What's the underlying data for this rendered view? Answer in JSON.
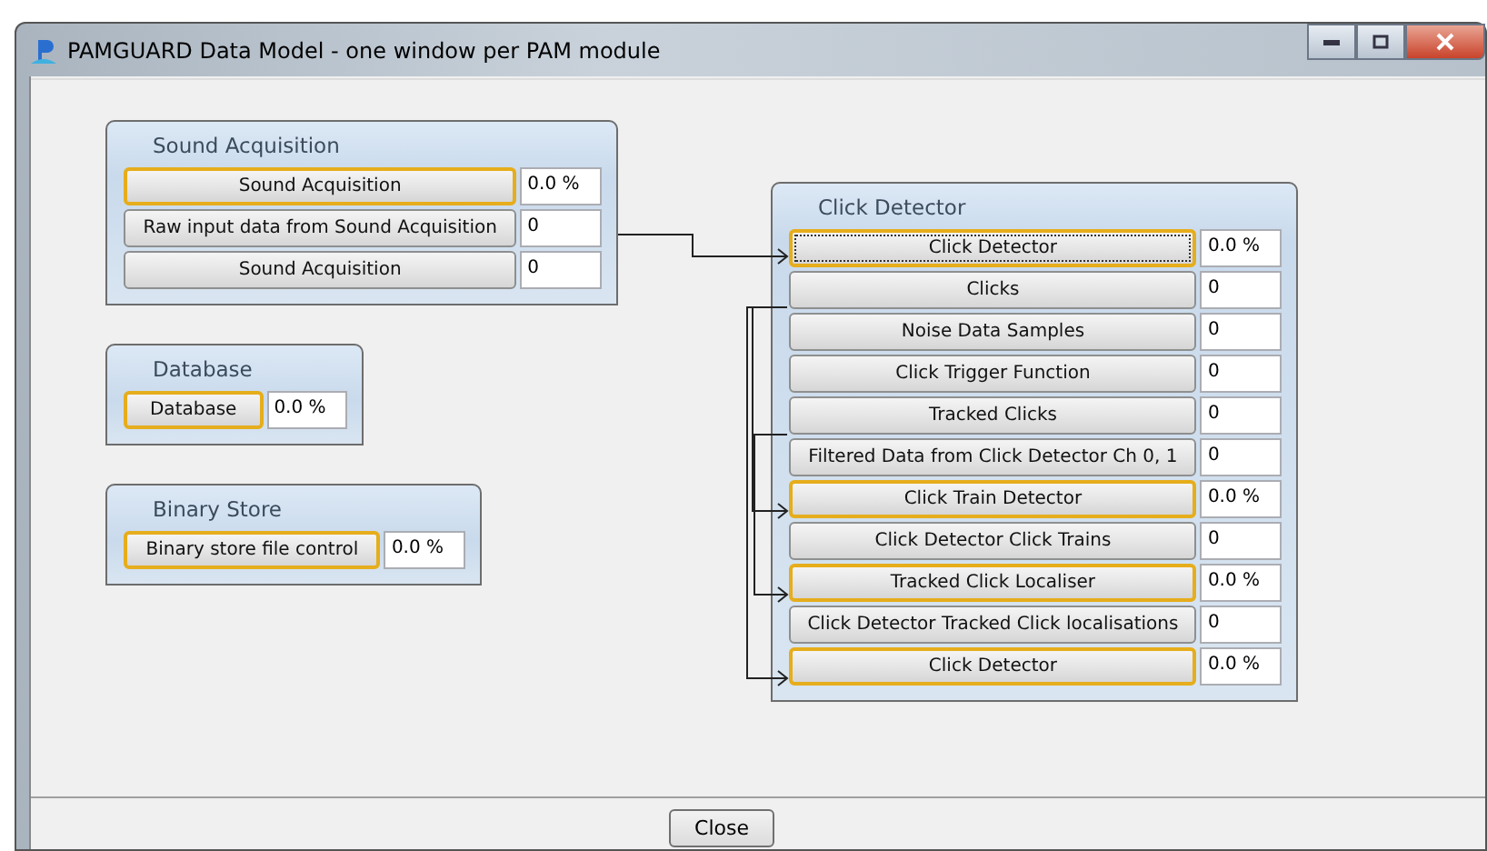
{
  "window": {
    "title": "PAMGUARD Data Model - one window per PAM module"
  },
  "modules": [
    {
      "title": "Sound Acquisition",
      "rows": [
        {
          "kind": "process",
          "label": "Sound Acquisition",
          "value": "0.0 %",
          "focused": false
        },
        {
          "kind": "data",
          "label": "Raw input data from Sound Acquisition",
          "value": "0",
          "focused": false
        },
        {
          "kind": "data",
          "label": "Sound Acquisition",
          "value": "0",
          "focused": false
        }
      ]
    },
    {
      "title": "Database",
      "rows": [
        {
          "kind": "process",
          "label": "Database",
          "value": "0.0 %",
          "focused": false
        }
      ]
    },
    {
      "title": "Binary Store",
      "rows": [
        {
          "kind": "process",
          "label": "Binary store file control",
          "value": "0.0 %",
          "focused": false
        }
      ]
    },
    {
      "title": "Click Detector",
      "rows": [
        {
          "kind": "process",
          "label": "Click Detector",
          "value": "0.0 %",
          "focused": true
        },
        {
          "kind": "data",
          "label": "Clicks",
          "value": "0",
          "focused": false
        },
        {
          "kind": "data",
          "label": "Noise Data Samples",
          "value": "0",
          "focused": false
        },
        {
          "kind": "data",
          "label": "Click Trigger Function",
          "value": "0",
          "focused": false
        },
        {
          "kind": "data",
          "label": "Tracked Clicks",
          "value": "0",
          "focused": false
        },
        {
          "kind": "data",
          "label": "Filtered Data from Click Detector Ch 0, 1",
          "value": "0",
          "focused": false
        },
        {
          "kind": "process",
          "label": "Click Train Detector",
          "value": "0.0 %",
          "focused": false
        },
        {
          "kind": "data",
          "label": "Click Detector Click Trains",
          "value": "0",
          "focused": false
        },
        {
          "kind": "process",
          "label": "Tracked Click Localiser",
          "value": "0.0 %",
          "focused": false
        },
        {
          "kind": "data",
          "label": "Click Detector Tracked Click localisations",
          "value": "0",
          "focused": false
        },
        {
          "kind": "process",
          "label": "Click Detector",
          "value": "0.0 %",
          "focused": false
        }
      ]
    }
  ],
  "buttons": [
    "Close"
  ]
}
